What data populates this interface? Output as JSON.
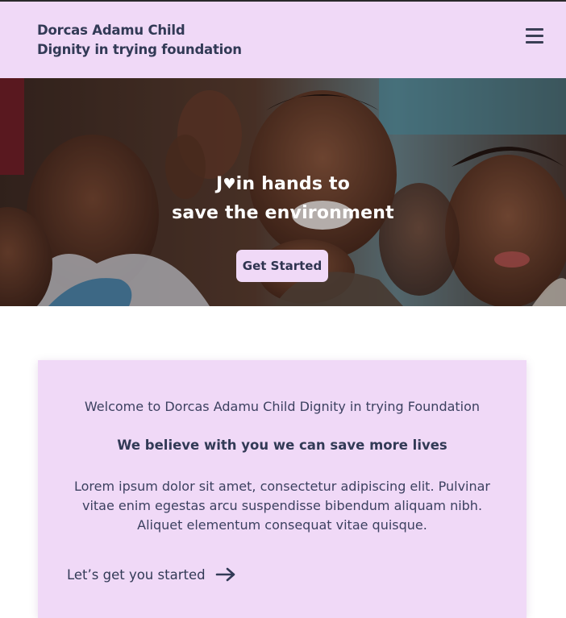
{
  "header": {
    "brand_line1": "Dorcas Adamu Child",
    "brand_line2": "Dignity in trying foundation",
    "menu_icon": "hamburger-menu-icon"
  },
  "hero": {
    "title_line1_prefix": "J",
    "title_line1_heart": "♥",
    "title_line1_suffix": "in hands to",
    "title_line2": "save the environment",
    "cta_label": "Get Started"
  },
  "card": {
    "welcome": "Welcome to Dorcas Adamu Child Dignity in trying Foundation",
    "belief": "We believe with you we can save more lives",
    "body": "Lorem ipsum dolor sit amet, consectetur adipiscing elit. Pulvinar vitae enim egestas arcu suspendisse bibendum aliquam nibh. Aliquet elementum consequat vitae quisque.",
    "link_label": "Let’s get you started",
    "link_icon": "arrow-right-icon"
  },
  "colors": {
    "lavender": "#f0d9f7",
    "text_dark": "#323a56"
  }
}
